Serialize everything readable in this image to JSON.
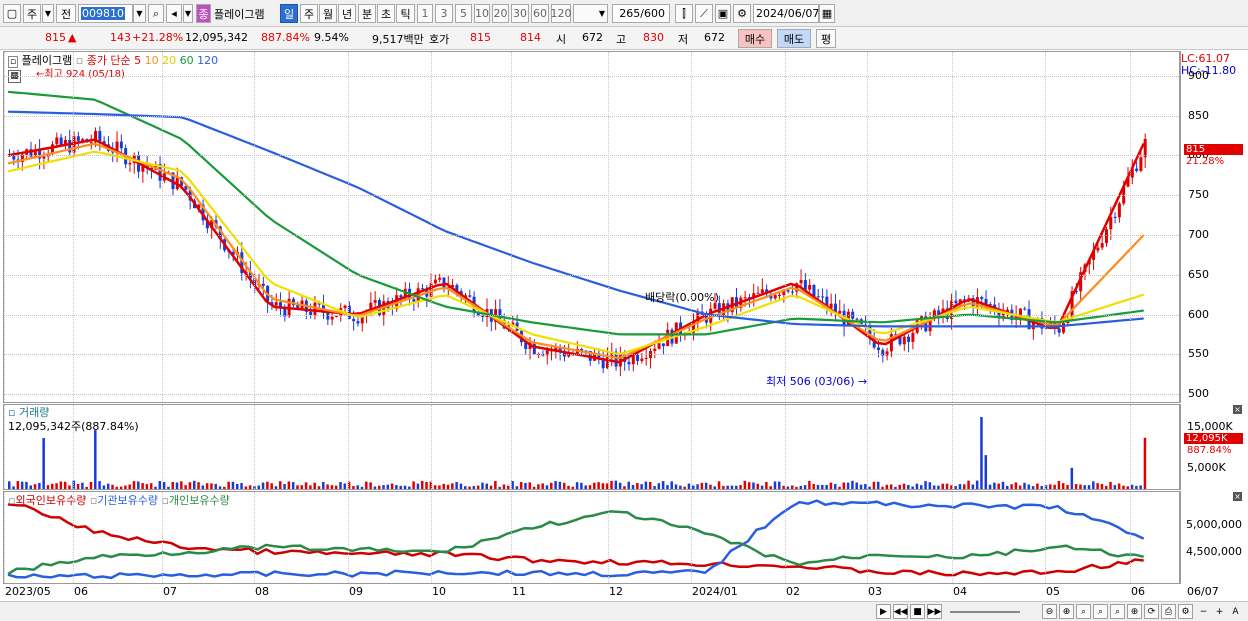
{
  "toolbar": {
    "market": "주",
    "market2": "전",
    "code": "009810",
    "badge": "종",
    "name": "플레이그램",
    "periods": [
      "일",
      "주",
      "월",
      "년",
      "분",
      "초",
      "틱"
    ],
    "active_period": "일",
    "nums": [
      "1",
      "3",
      "5",
      "10",
      "20",
      "30",
      "60",
      "120"
    ],
    "count": "265",
    "count_total": "/600",
    "date": "2024/06/07"
  },
  "quote": {
    "price": "815",
    "arrow": "▲",
    "change": "143",
    "change_pct": "+21.28%",
    "volume": "12,095,342",
    "volume_pct": "887.84%",
    "turnover": "9.54%",
    "amount": "9,517백만",
    "ask_label": "호가",
    "ask": "815",
    "bid": "814",
    "open_label": "시",
    "open": "672",
    "high_label": "고",
    "high": "830",
    "low_label": "저",
    "low": "672",
    "buy": "매수",
    "sell": "매도",
    "eval": "평"
  },
  "price_pane": {
    "name": "플레이그램",
    "ma_label": "종가 단순",
    "ma_periods": [
      "5",
      "10",
      "20",
      "60",
      "120"
    ],
    "ma_colors": [
      "#e00000",
      "#ff8c1a",
      "#f0e000",
      "#1a9a3a",
      "#2a5ee0"
    ],
    "high_note": "최고 924 (05/18)",
    "low_note": "최저 506 (03/06)",
    "dividend_note": "배당락(0.00%)",
    "lc": "LC:61.07",
    "hc": "HC:-11.80",
    "ticks": [
      "900",
      "850",
      "800",
      "750",
      "700",
      "650",
      "600",
      "550",
      "500"
    ],
    "last_price": "815",
    "last_pct": "21.28%"
  },
  "volume_pane": {
    "title": "거래량",
    "value": "12,095,342주(887.84%)",
    "ticks": [
      "15,000K",
      "5,000K"
    ],
    "last": "12,095K",
    "last_pct": "887.84%"
  },
  "holding_pane": {
    "series": [
      "외국인보유수량",
      "기관보유수량",
      "개인보유수량"
    ],
    "colors": [
      "#d00000",
      "#2a5ee0",
      "#2a8a4a"
    ],
    "ticks": [
      "5,000,000",
      "4,500,000"
    ]
  },
  "x_axis": [
    "2023/05",
    "06",
    "07",
    "08",
    "09",
    "10",
    "11",
    "12",
    "2024/01",
    "02",
    "03",
    "04",
    "05",
    "06"
  ],
  "x_end": "06/07",
  "chart_data": {
    "type": "line",
    "title": "",
    "x": [
      "2023/05",
      "06",
      "07",
      "08",
      "09",
      "10",
      "11",
      "12",
      "2024/01",
      "02",
      "03",
      "04",
      "05",
      "06"
    ],
    "series": [
      {
        "name": "5",
        "values": [
          800,
          820,
          760,
          610,
          600,
          640,
          560,
          540,
          600,
          640,
          560,
          620,
          580,
          815
        ]
      },
      {
        "name": "10",
        "values": [
          790,
          815,
          770,
          620,
          598,
          635,
          565,
          545,
          595,
          635,
          565,
          615,
          585,
          700
        ]
      },
      {
        "name": "20",
        "values": [
          780,
          805,
          780,
          640,
          596,
          625,
          575,
          550,
          585,
          625,
          575,
          610,
          590,
          625
        ]
      },
      {
        "name": "60",
        "values": [
          880,
          870,
          820,
          720,
          650,
          610,
          590,
          575,
          575,
          595,
          590,
          600,
          590,
          605
        ]
      },
      {
        "name": "120",
        "values": [
          855,
          852,
          848,
          805,
          760,
          705,
          665,
          630,
          600,
          588,
          585,
          585,
          585,
          595
        ]
      }
    ],
    "ylim": [
      490,
      930
    ],
    "grid": true
  }
}
